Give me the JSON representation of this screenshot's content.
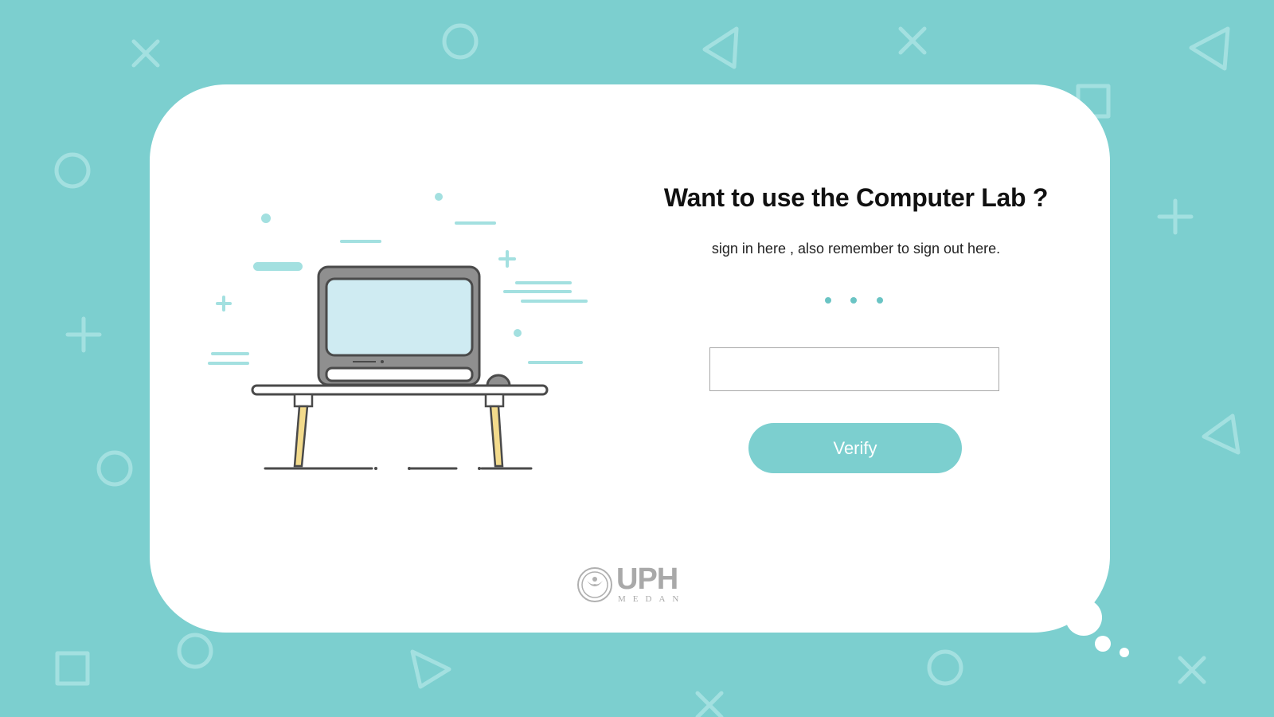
{
  "colors": {
    "background": "#7ccfcf",
    "card": "#ffffff",
    "accent": "#7ccfcf",
    "title_text": "#111111"
  },
  "heading": {
    "title": "Want to use the Computer Lab ?",
    "subtitle": "sign in here , also remember to sign out here."
  },
  "loading_indicator": {
    "icon": "three-dots-icon"
  },
  "form": {
    "input_value": "",
    "input_placeholder": "",
    "verify_label": "Verify"
  },
  "illustration": {
    "icon": "laptop-on-desk-illustration"
  },
  "logo": {
    "name": "UPH",
    "sub": "MEDAN"
  }
}
